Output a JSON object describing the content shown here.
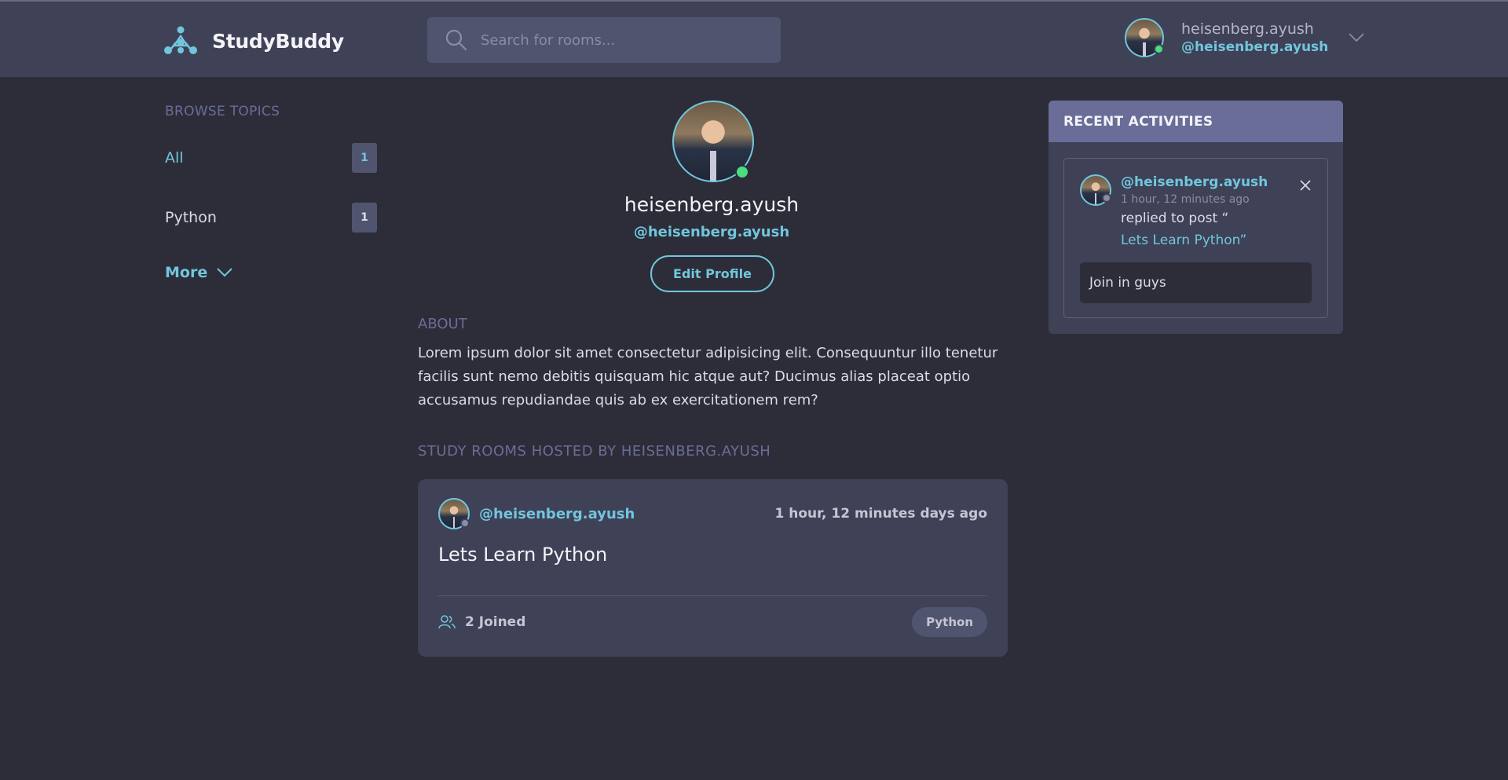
{
  "app": {
    "name": "StudyBuddy"
  },
  "search": {
    "placeholder": "Search for rooms..."
  },
  "current_user": {
    "name": "heisenberg.ayush",
    "handle": "@heisenberg.ayush",
    "online": true
  },
  "sidebar": {
    "title": "BROWSE TOPICS",
    "topics": [
      {
        "label": "All",
        "count": "1",
        "active": true
      },
      {
        "label": "Python",
        "count": "1",
        "active": false
      }
    ],
    "more_label": "More"
  },
  "profile": {
    "name": "heisenberg.ayush",
    "handle": "@heisenberg.ayush",
    "edit_label": "Edit Profile",
    "about_title": "ABOUT",
    "about_text": "Lorem ipsum dolor sit amet consectetur adipisicing elit. Consequuntur illo tenetur facilis sunt nemo debitis quisquam hic atque aut? Ducimus alias placeat optio accusamus repudiandae quis ab ex exercitationem rem?",
    "rooms_title": "STUDY ROOMS HOSTED BY HEISENBERG.AYUSH"
  },
  "rooms": [
    {
      "host_handle": "@heisenberg.ayush",
      "time": "1 hour, 12 minutes days ago",
      "title": "Lets Learn Python",
      "joined": "2 Joined",
      "topic": "Python"
    }
  ],
  "activities": {
    "title": "RECENT ACTIVITIES",
    "items": [
      {
        "handle": "@heisenberg.ayush",
        "time": "1 hour, 12 minutes ago",
        "action": "replied to post “",
        "post": "Lets Learn Python”",
        "reply": "Join in guys"
      }
    ]
  },
  "colors": {
    "background": "#2d2d39",
    "header": "#3f4156",
    "accent": "#71c6dd",
    "muted": "#696d97",
    "online": "#4ade80"
  }
}
